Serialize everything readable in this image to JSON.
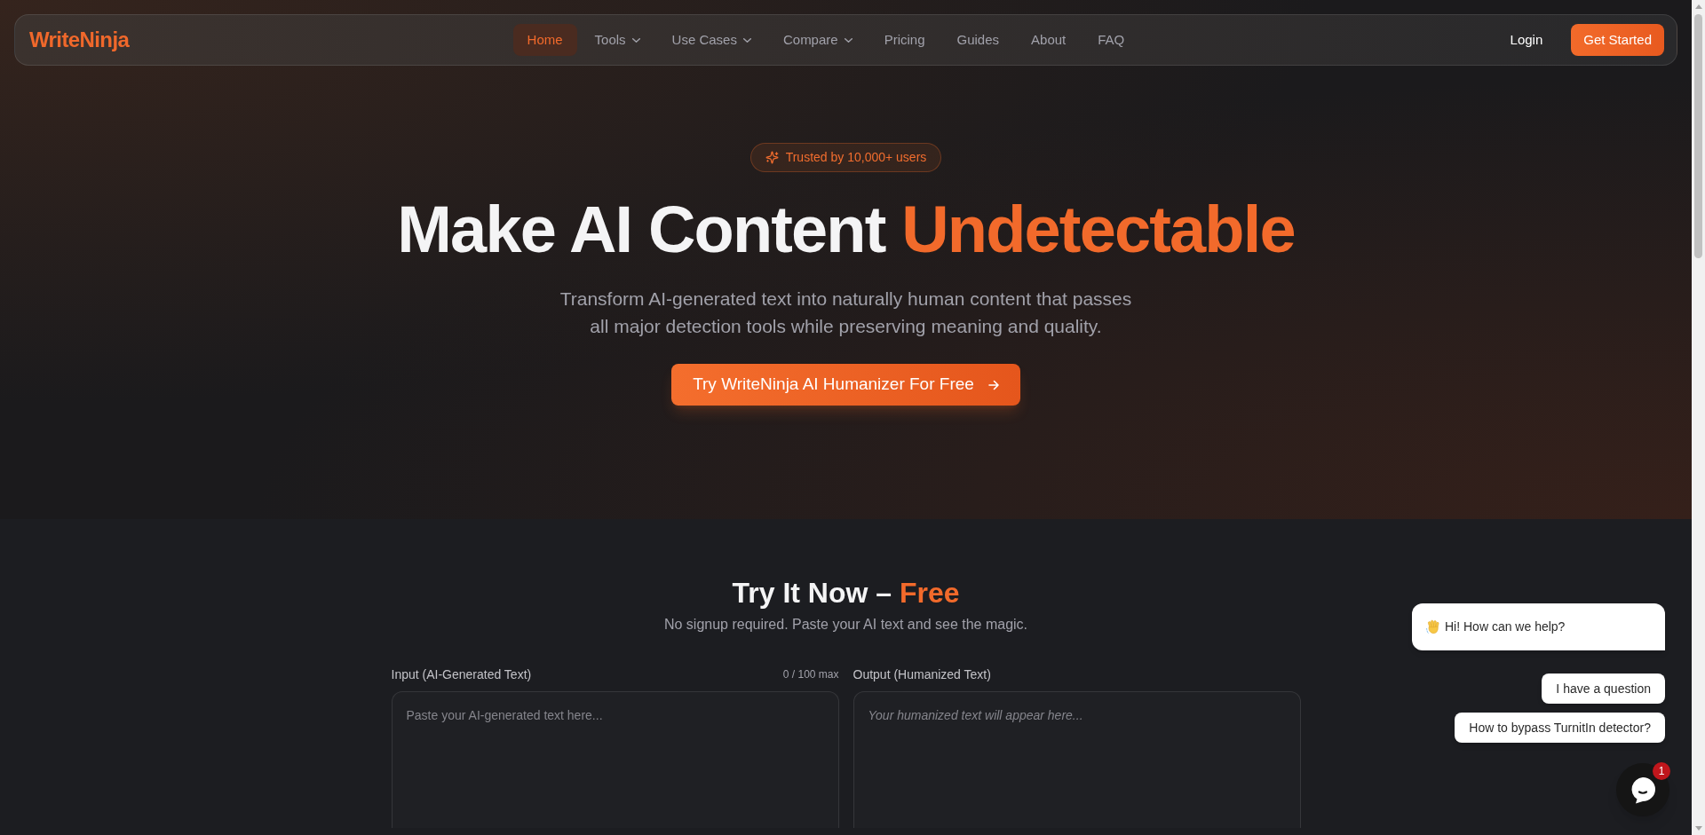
{
  "nav": {
    "logo": "WriteNinja",
    "items": [
      {
        "label": "Home",
        "selected": true,
        "dropdown": false
      },
      {
        "label": "Tools",
        "selected": false,
        "dropdown": true
      },
      {
        "label": "Use Cases",
        "selected": false,
        "dropdown": true
      },
      {
        "label": "Compare",
        "selected": false,
        "dropdown": true
      },
      {
        "label": "Pricing",
        "selected": false,
        "dropdown": false
      },
      {
        "label": "Guides",
        "selected": false,
        "dropdown": false
      },
      {
        "label": "About",
        "selected": false,
        "dropdown": false
      },
      {
        "label": "FAQ",
        "selected": false,
        "dropdown": false
      }
    ],
    "login": "Login",
    "cta": "Get Started"
  },
  "hero": {
    "badge": "Trusted by 10,000+ users",
    "title": "Make AI Content",
    "title_highlight": "Undetectable",
    "subtitle": "Transform AI-generated text into naturally human content that passes all major detection tools while preserving meaning and quality.",
    "cta": "Try WriteNinja AI Humanizer For Free"
  },
  "try_it": {
    "title": "Try It Now –",
    "title_highlight": "Free",
    "subtitle": "No signup required. Paste your AI text and see the magic.",
    "input": {
      "label": "Input (AI-Generated Text)",
      "counter": "0 / 100 max",
      "placeholder": "Paste your AI-generated text here..."
    },
    "output": {
      "label": "Output (Humanized Text)",
      "placeholder": "Your humanized text will appear here..."
    }
  },
  "chat_widget": {
    "greeting": "Hi! How can we help?",
    "quick_replies": [
      "I have a question",
      "How to bypass TurnitIn detector?"
    ],
    "unread_count": "1"
  }
}
